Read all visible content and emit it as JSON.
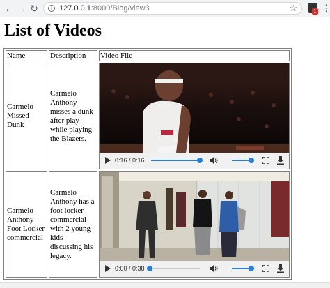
{
  "browser": {
    "url_host": "127.0.0.1",
    "url_rest": ":8000/Blog/view3",
    "back_icon": "back-arrow-icon",
    "forward_icon": "forward-arrow-icon",
    "reload_icon": "reload-icon",
    "extension_badge": "1"
  },
  "page": {
    "title": "List of Videos"
  },
  "table": {
    "headers": {
      "name": "Name",
      "description": "Description",
      "video": "Video File"
    },
    "rows": [
      {
        "name": "Carmelo Missed Dunk",
        "description": "Carmelo Anthony misses a dunk after play while playing the Blazers.",
        "video": {
          "time": "0:16 / 0:16",
          "progress": 1.0,
          "volume": 1.0,
          "thumbnail": "basketball-player-on-court"
        }
      },
      {
        "name": "Carmelo Anthony Foot Locker commercial",
        "description": "Carmelo Anthony has a foot locker commercial with 2 young kids discussing his legacy.",
        "video": {
          "time": "0:00 / 0:38",
          "progress": 0.0,
          "volume": 1.0,
          "thumbnail": "three-people-in-hallway"
        }
      }
    ]
  }
}
